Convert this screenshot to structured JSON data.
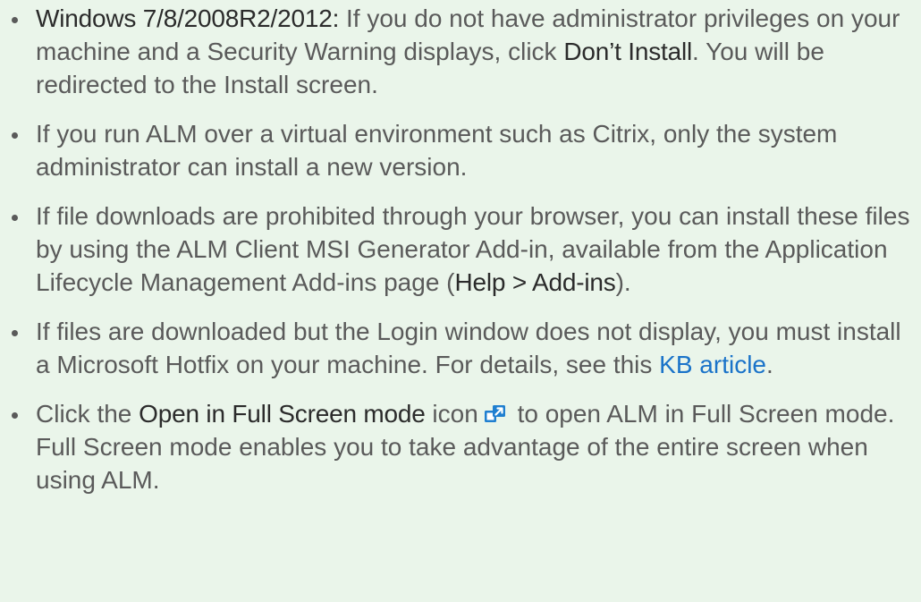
{
  "items": [
    {
      "bold_prefix": "Windows 7/8/2008R2/2012:",
      "text_before": " If you do not have administrator privileges on your machine and a Security Warning displays, click ",
      "bold_action": "Don’t Install",
      "text_after": ". You will be redirected to the Install screen."
    },
    {
      "text": "If you run ALM over a virtual environment such as Citrix, only the system administrator can install a new version."
    },
    {
      "text_before": "If file downloads are prohibited through your browser, you can install these files by using the ALM Client MSI Generator Add-in, available from the Application Lifecycle Management Add-ins page (",
      "bold_path": "Help > Add-ins",
      "text_after": ")."
    },
    {
      "text_before": "If files are downloaded but the Login window does not display, you must install a Microsoft Hotfix on your machine. For details, see this ",
      "link_text": "KB article",
      "text_after": "."
    },
    {
      "text_before": "Click the ",
      "bold_name": "Open in Full Screen mode",
      "text_mid": " icon",
      "icon": "open-full-screen-icon",
      "text_after": " to open ALM in Full Screen mode. Full Screen mode enables you to take advantage of the entire screen when using ALM."
    }
  ],
  "colors": {
    "background": "#eaf5ea",
    "text": "#5a5a5a",
    "bold_text": "#2b2b2b",
    "link": "#1a73c9",
    "icon_blue": "#1f7fd0"
  }
}
